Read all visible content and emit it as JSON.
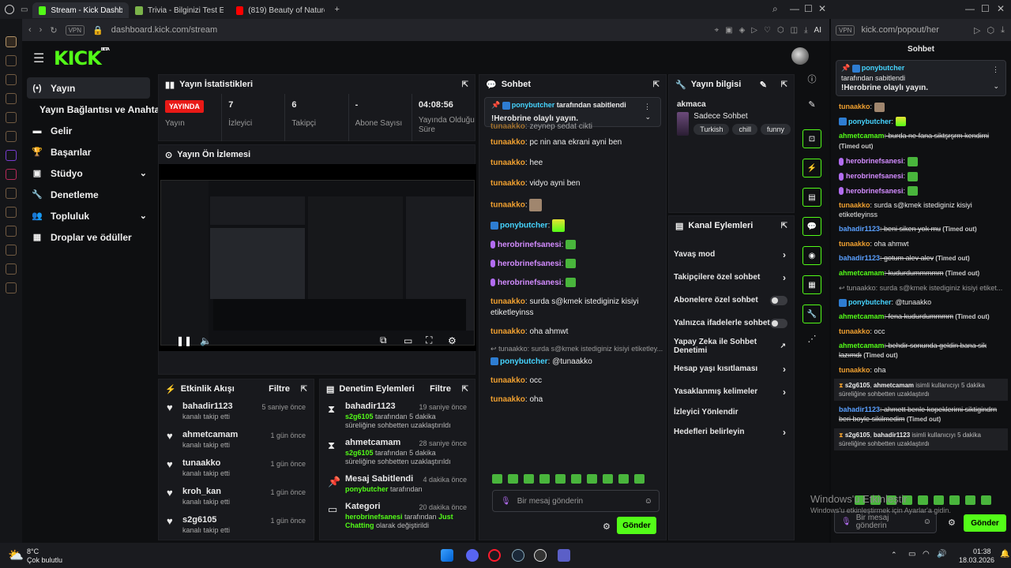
{
  "browser": {
    "tabs": [
      {
        "label": "Stream - Kick Dashboard",
        "active": true
      },
      {
        "label": "Trivia - Bilginizi Test Edin",
        "active": false
      },
      {
        "label": "(819) Beauty of Nature | Fa",
        "active": false
      }
    ],
    "vpn": "VPN",
    "url": "dashboard.kick.com/stream",
    "ai": "AI",
    "popout_url": "kick.com/popout/her"
  },
  "logo": "KICK",
  "logo_beta": "BETA",
  "nav": {
    "items": [
      {
        "label": "Yayın",
        "icon": "(•)",
        "icon_name": "live-icon",
        "active": true
      },
      {
        "label": "Yayın Bağlantısı ve Anahtarı",
        "icon": "",
        "icon_name": "key-icon"
      },
      {
        "label": "Gelir",
        "icon": "▬",
        "icon_name": "revenue-icon"
      },
      {
        "label": "Başarılar",
        "icon": "🏆",
        "icon_name": "trophy-icon"
      },
      {
        "label": "Stüdyo",
        "icon": "▣",
        "icon_name": "studio-icon",
        "chev": "⌄"
      },
      {
        "label": "Denetleme",
        "icon": "🔧",
        "icon_name": "wrench-icon"
      },
      {
        "label": "Topluluk",
        "icon": "👥",
        "icon_name": "community-icon",
        "chev": "⌄"
      },
      {
        "label": "Droplar ve ödüller",
        "icon": "▦",
        "icon_name": "drops-icon"
      }
    ]
  },
  "stats": {
    "title": "Yayın İstatistikleri",
    "live_badge": "YAYINDA",
    "cols": [
      {
        "value": "",
        "label": "Yayın"
      },
      {
        "value": "7",
        "label": "İzleyici"
      },
      {
        "value": "6",
        "label": "Takipçi"
      },
      {
        "value": "-",
        "label": "Abone Sayısı"
      },
      {
        "value": "04:08:56",
        "label": "Yayında Olduğu Süre"
      }
    ]
  },
  "preview": {
    "title": "Yayın Ön İzlemesi"
  },
  "activity": {
    "title": "Etkinlik Akışı",
    "filter": "Filtre",
    "rows": [
      {
        "name": "bahadir1123",
        "sub": "kanalı takip etti",
        "time": "5 saniye önce"
      },
      {
        "name": "ahmetcamam",
        "sub": "kanalı takip etti",
        "time": "1 gün önce"
      },
      {
        "name": "tunaakko",
        "sub": "kanalı takip etti",
        "time": "1 gün önce"
      },
      {
        "name": "kroh_kan",
        "sub": "kanalı takip etti",
        "time": "1 gün önce"
      },
      {
        "name": "s2g6105",
        "sub": "kanalı takip etti",
        "time": "1 gün önce"
      }
    ]
  },
  "mod": {
    "title": "Denetim Eylemleri",
    "filter": "Filtre",
    "rows": [
      {
        "icon": "⧗",
        "name": "bahadir1123",
        "actor": "s2g6105",
        "desc": " tarafından 5 dakika süreliğine sohbetten uzaklaştırıldı",
        "time": "19 saniye önce"
      },
      {
        "icon": "⧗",
        "name": "ahmetcamam",
        "actor": "s2g6105",
        "desc": " tarafından 5 dakika süreliğine sohbetten uzaklaştırıldı",
        "time": "28 saniye önce"
      },
      {
        "icon": "📌",
        "name": "Mesaj Sabitlendi",
        "actor": "ponybutcher",
        "desc": " tarafından",
        "time": "4 dakika önce"
      },
      {
        "icon": "▭",
        "name": "Kategori",
        "actor": "herobrinefsanesi",
        "desc": " tarafından ",
        "extra": "Just Chatting",
        "desc2": " olarak değiştirildi",
        "time": "20 dakika önce"
      }
    ]
  },
  "chat": {
    "title": "Sohbet",
    "pinned_by": "ponybutcher",
    "pinned_suffix": "tarafından sabitlendi",
    "pinned_text": "!Herobrine olaylı yayın.",
    "messages": [
      {
        "user": "tunaakko",
        "text": ": zeynep sedat cikti"
      },
      {
        "user": "tunaakko",
        "text": ": pc nin ana ekrani ayni ben"
      },
      {
        "user": "tunaakko",
        "text": ": hee"
      },
      {
        "user": "tunaakko",
        "text": ": vidyo ayni ben"
      },
      {
        "user": "tunaakko",
        "text": ":"
      },
      {
        "user": "ponybutcher",
        "text": ":"
      },
      {
        "user": "herobrinefsanesi",
        "text": ":"
      },
      {
        "user": "herobrinefsanesi",
        "text": ":"
      },
      {
        "user": "herobrinefsanesi",
        "text": ":"
      },
      {
        "user": "tunaakko",
        "text": ": surda s@kmek istediginiz kisiyi etiketleyinss"
      },
      {
        "user": "tunaakko",
        "text": ": oha ahmwt"
      }
    ],
    "reply_hint": "tunaakko: surda s@kmek istediginiz kisiyi etiketley...",
    "after": [
      {
        "user": "ponybutcher",
        "text": ": @tunaakko"
      },
      {
        "user": "tunaakko",
        "text": ": occ"
      },
      {
        "user": "tunaakko",
        "text": ": oha"
      }
    ],
    "placeholder": "Bir mesaj gönderin",
    "send": "Gönder"
  },
  "info": {
    "title": "Yayın bilgisi",
    "stream_title": "akmaca",
    "category": "Sadece Sohbet",
    "tags": [
      "Turkish",
      "chill",
      "funny"
    ]
  },
  "channel_actions": {
    "title": "Kanal Eylemleri",
    "rows": [
      {
        "label": "Yavaş mod",
        "control": "arrow"
      },
      {
        "label": "Takipçilere özel sohbet",
        "control": "arrow"
      },
      {
        "label": "Abonelere özel sohbet",
        "control": "toggle"
      },
      {
        "label": "Yalnızca ifadelerle sohbet",
        "control": "toggle"
      },
      {
        "label": "Yapay Zeka ile Sohbet Denetimi",
        "control": "ext"
      },
      {
        "label": "Hesap yaşı kısıtlaması",
        "control": "arrow"
      },
      {
        "label": "Yasaklanmış kelimeler",
        "control": "arrow"
      },
      {
        "label": "İzleyici Yönlendir",
        "control": "none"
      },
      {
        "label": "Hedefleri belirleyin",
        "control": "arrow"
      }
    ]
  },
  "popout": {
    "title": "Sohbet",
    "pinned_by": "ponybutcher",
    "pinned_suffix": "tarafından sabitlendi",
    "pinned_text": "!Herobrine olaylı yayın.",
    "placeholder": "Bir mesaj gönderin",
    "send": "Gönder",
    "messages": [
      {
        "kind": "msg",
        "user": "tunaakko",
        "cls": "u-or",
        "text": ":"
      },
      {
        "kind": "msg",
        "user": "ponybutcher",
        "cls": "u-cy",
        "text": ":"
      },
      {
        "kind": "msg",
        "user": "ahmetcamam",
        "cls": "u-gr",
        "text": ": burda ne fana siktşrşrm kendimi",
        "strike": true,
        "timed": "(Timed out)"
      },
      {
        "kind": "msg",
        "user": "herobrinefsanesi",
        "cls": "u-pk",
        "text": ":"
      },
      {
        "kind": "msg",
        "user": "herobrinefsanesi",
        "cls": "u-pk",
        "text": ":"
      },
      {
        "kind": "msg",
        "user": "herobrinefsanesi",
        "cls": "u-pk",
        "text": ":"
      },
      {
        "kind": "msg",
        "user": "tunaakko",
        "cls": "u-or",
        "text": ": surda s@kmek istediginiz kisiyi etiketleyinss"
      },
      {
        "kind": "msg",
        "user": "bahadir1123",
        "cls": "u-bl",
        "text": ": beni siken yok mu",
        "strike": true,
        "timed": "(Timed out)"
      },
      {
        "kind": "msg",
        "user": "tunaakko",
        "cls": "u-or",
        "text": ": oha ahmwt"
      },
      {
        "kind": "msg",
        "user": "bahadir1123",
        "cls": "u-bl",
        "text": ": gotum alev alev",
        "strike": true,
        "timed": "(Timed out)"
      },
      {
        "kind": "msg",
        "user": "ahmetcamam",
        "cls": "u-gr",
        "text": ": kudurdummmmm",
        "strike": true,
        "timed": "(Timed out)"
      },
      {
        "kind": "reply",
        "text": "tunaakko: surda s@kmek istediginiz kisiyi etiket..."
      },
      {
        "kind": "msg",
        "user": "ponybutcher",
        "cls": "u-cy",
        "text": ": @tunaakko"
      },
      {
        "kind": "msg",
        "user": "ahmetcamam",
        "cls": "u-gr",
        "text": ": fena kudurdummmm",
        "strike": true,
        "timed": "(Timed out)"
      },
      {
        "kind": "msg",
        "user": "tunaakko",
        "cls": "u-or",
        "text": ": occ"
      },
      {
        "kind": "msg",
        "user": "ahmetcamam",
        "cls": "u-gr",
        "text": ": behdir sonunda geldin bana sik lazımdı",
        "strike": true,
        "timed": "(Timed out)"
      },
      {
        "kind": "msg",
        "user": "tunaakko",
        "cls": "u-or",
        "text": ": oha"
      },
      {
        "kind": "sys",
        "actor": "s2g6105",
        "target": "ahmetcamam",
        "text": " isimli kullanıcıyı 5 dakika süreliğine sohbetten uzaklaştırdı"
      },
      {
        "kind": "msg",
        "user": "bahadir1123",
        "cls": "u-bl",
        "text": ": ahmett benle kopeklerimi siktigindrn beri boyle sikilmedim",
        "strike": true,
        "timed": "(Timed out)"
      },
      {
        "kind": "sys",
        "actor": "s2g6105",
        "target": "bahadir1123",
        "text": " isimli kullanıcıyı 5 dakika süreliğine sohbetten uzaklaştırdı"
      }
    ]
  },
  "watermark": {
    "line1": "Windows'u Etkinleştir",
    "line2": "Windows'u etkinleştirmek için Ayarlar'a gidin."
  },
  "taskbar": {
    "temp": "8°C",
    "weather": "Çok bulutlu",
    "time": "01:38",
    "date": "18.03.2026"
  },
  "colors": {
    "accent": "#53fc18",
    "live": "#e91916",
    "bg": "#0e0f11"
  }
}
